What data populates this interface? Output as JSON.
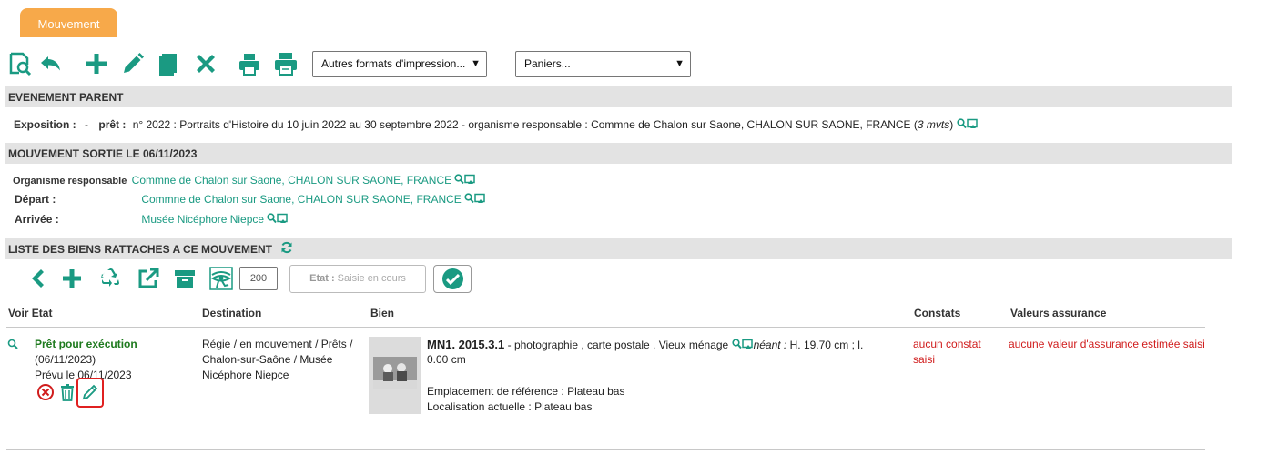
{
  "tab": {
    "label": "Mouvement"
  },
  "toolbar": {
    "print_formats_select": "Autres formats d'impression...",
    "baskets_select": "Paniers..."
  },
  "parent_event": {
    "header": "EVENEMENT PARENT",
    "exposition_label": "Exposition :",
    "exposition_value": "-",
    "pret_label": "prêt :",
    "pret_value": "n° 2022 : Portraits d'Histoire du 10 juin 2022 au 30 septembre 2022 - organisme responsable : Commne de Chalon sur Saone, CHALON SUR SAONE, FRANCE",
    "pret_count_open": "(",
    "pret_count": "3 mvts",
    "pret_count_close": ")"
  },
  "movement": {
    "header": "MOUVEMENT SORTIE LE 06/11/2023",
    "organisme_label": "Organisme responsable",
    "organisme_value": "Commne de Chalon sur Saone, CHALON SUR SAONE, FRANCE",
    "depart_label": "Départ :",
    "depart_value": "Commne de Chalon sur Saone, CHALON SUR SAONE, FRANCE",
    "arrivee_label": "Arrivée :",
    "arrivee_value": "Musée Nicéphore Niepce"
  },
  "list": {
    "header": "LISTE DES BIENS RATTACHES A CE MOUVEMENT",
    "count_value": "200",
    "etat_label": "Etat :",
    "etat_placeholder": "Saisie en cours",
    "columns": {
      "voir_etat": "Voir Etat",
      "destination": "Destination",
      "bien": "Bien",
      "constats": "Constats",
      "valeurs": "Valeurs assurance"
    },
    "rows": [
      {
        "status": "Prêt pour exécution",
        "status_date": "(06/11/2023)",
        "prevu": "Prévu le 06/11/2023",
        "destination": "Régie / en mouvement / Prêts / Chalon-sur-Saône / Musée Nicéphore Niepce",
        "bien_id": "MN1. 2015.3.1",
        "bien_desc": " - photographie , carte postale , Vieux ménage",
        "neant_label": "néant :",
        "dimensions_1": "H. 19.70 cm ;  l.",
        "dimensions_2": "0.00 cm",
        "emplacement": "Emplacement de référence : Plateau bas",
        "localisation": "Localisation actuelle : Plateau bas",
        "constats": "aucun constat saisi",
        "valeurs": "aucune valeur d'assurance estimée saisi"
      }
    ]
  },
  "colors": {
    "accent": "#1a9a82",
    "tab": "#f7a94a",
    "section_bg": "#e3e3e3",
    "alert": "#d01c1c",
    "status_green": "#1e7a1e"
  }
}
